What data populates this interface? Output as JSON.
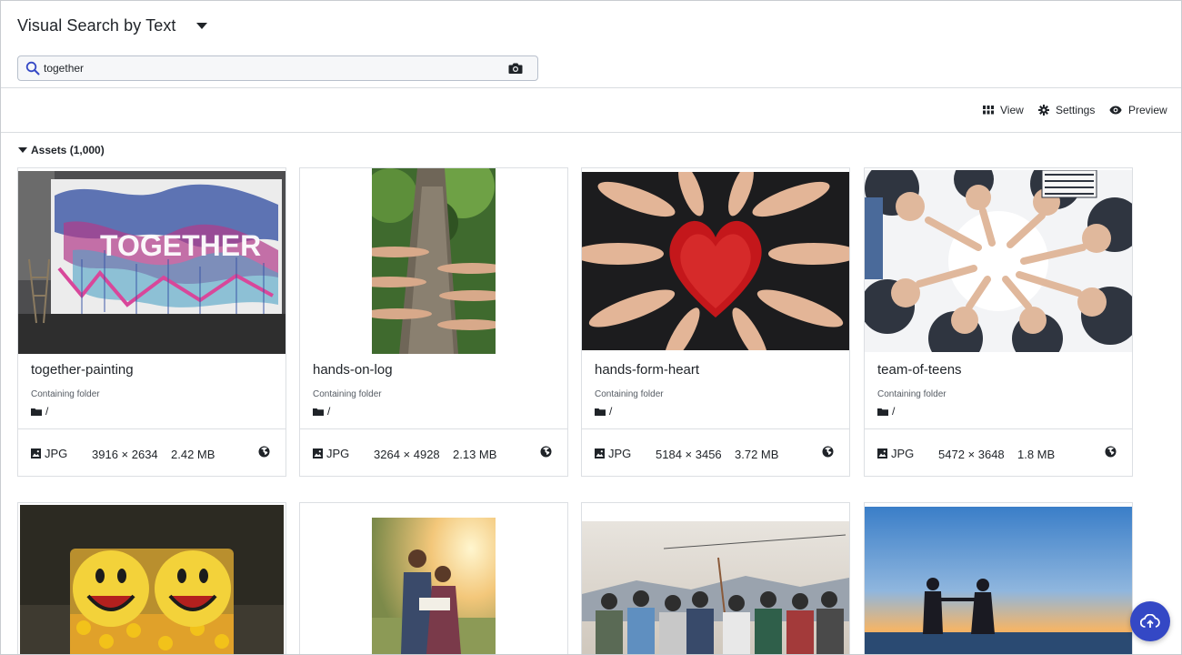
{
  "header": {
    "title": "Visual Search by Text",
    "search": {
      "value": "together",
      "placeholder": ""
    }
  },
  "toolbar": {
    "view_label": "View",
    "settings_label": "Settings",
    "preview_label": "Preview"
  },
  "assets": {
    "label": "Assets (1,000)",
    "folder_label": "Containing folder",
    "cards": [
      {
        "name": "together-painting",
        "folder": "/",
        "format": "JPG",
        "dimensions": "3916 × 2634",
        "size": "2.42 MB"
      },
      {
        "name": "hands-on-log",
        "folder": "/",
        "format": "JPG",
        "dimensions": "3264 × 4928",
        "size": "2.13 MB"
      },
      {
        "name": "hands-form-heart",
        "folder": "/",
        "format": "JPG",
        "dimensions": "5184 × 3456",
        "size": "3.72 MB"
      },
      {
        "name": "team-of-teens",
        "folder": "/",
        "format": "JPG",
        "dimensions": "5472 × 3648",
        "size": "1.8 MB"
      }
    ],
    "thumbnail_text": "TOGETHER"
  },
  "colors": {
    "accent": "#3448c5",
    "text": "#1f2328",
    "border": "#dcdfe3"
  },
  "icons": [
    "search-icon",
    "camera-icon",
    "grid-icon",
    "gear-icon",
    "eye-icon",
    "folder-icon",
    "image-icon",
    "globe-icon",
    "cloud-upload-icon"
  ]
}
